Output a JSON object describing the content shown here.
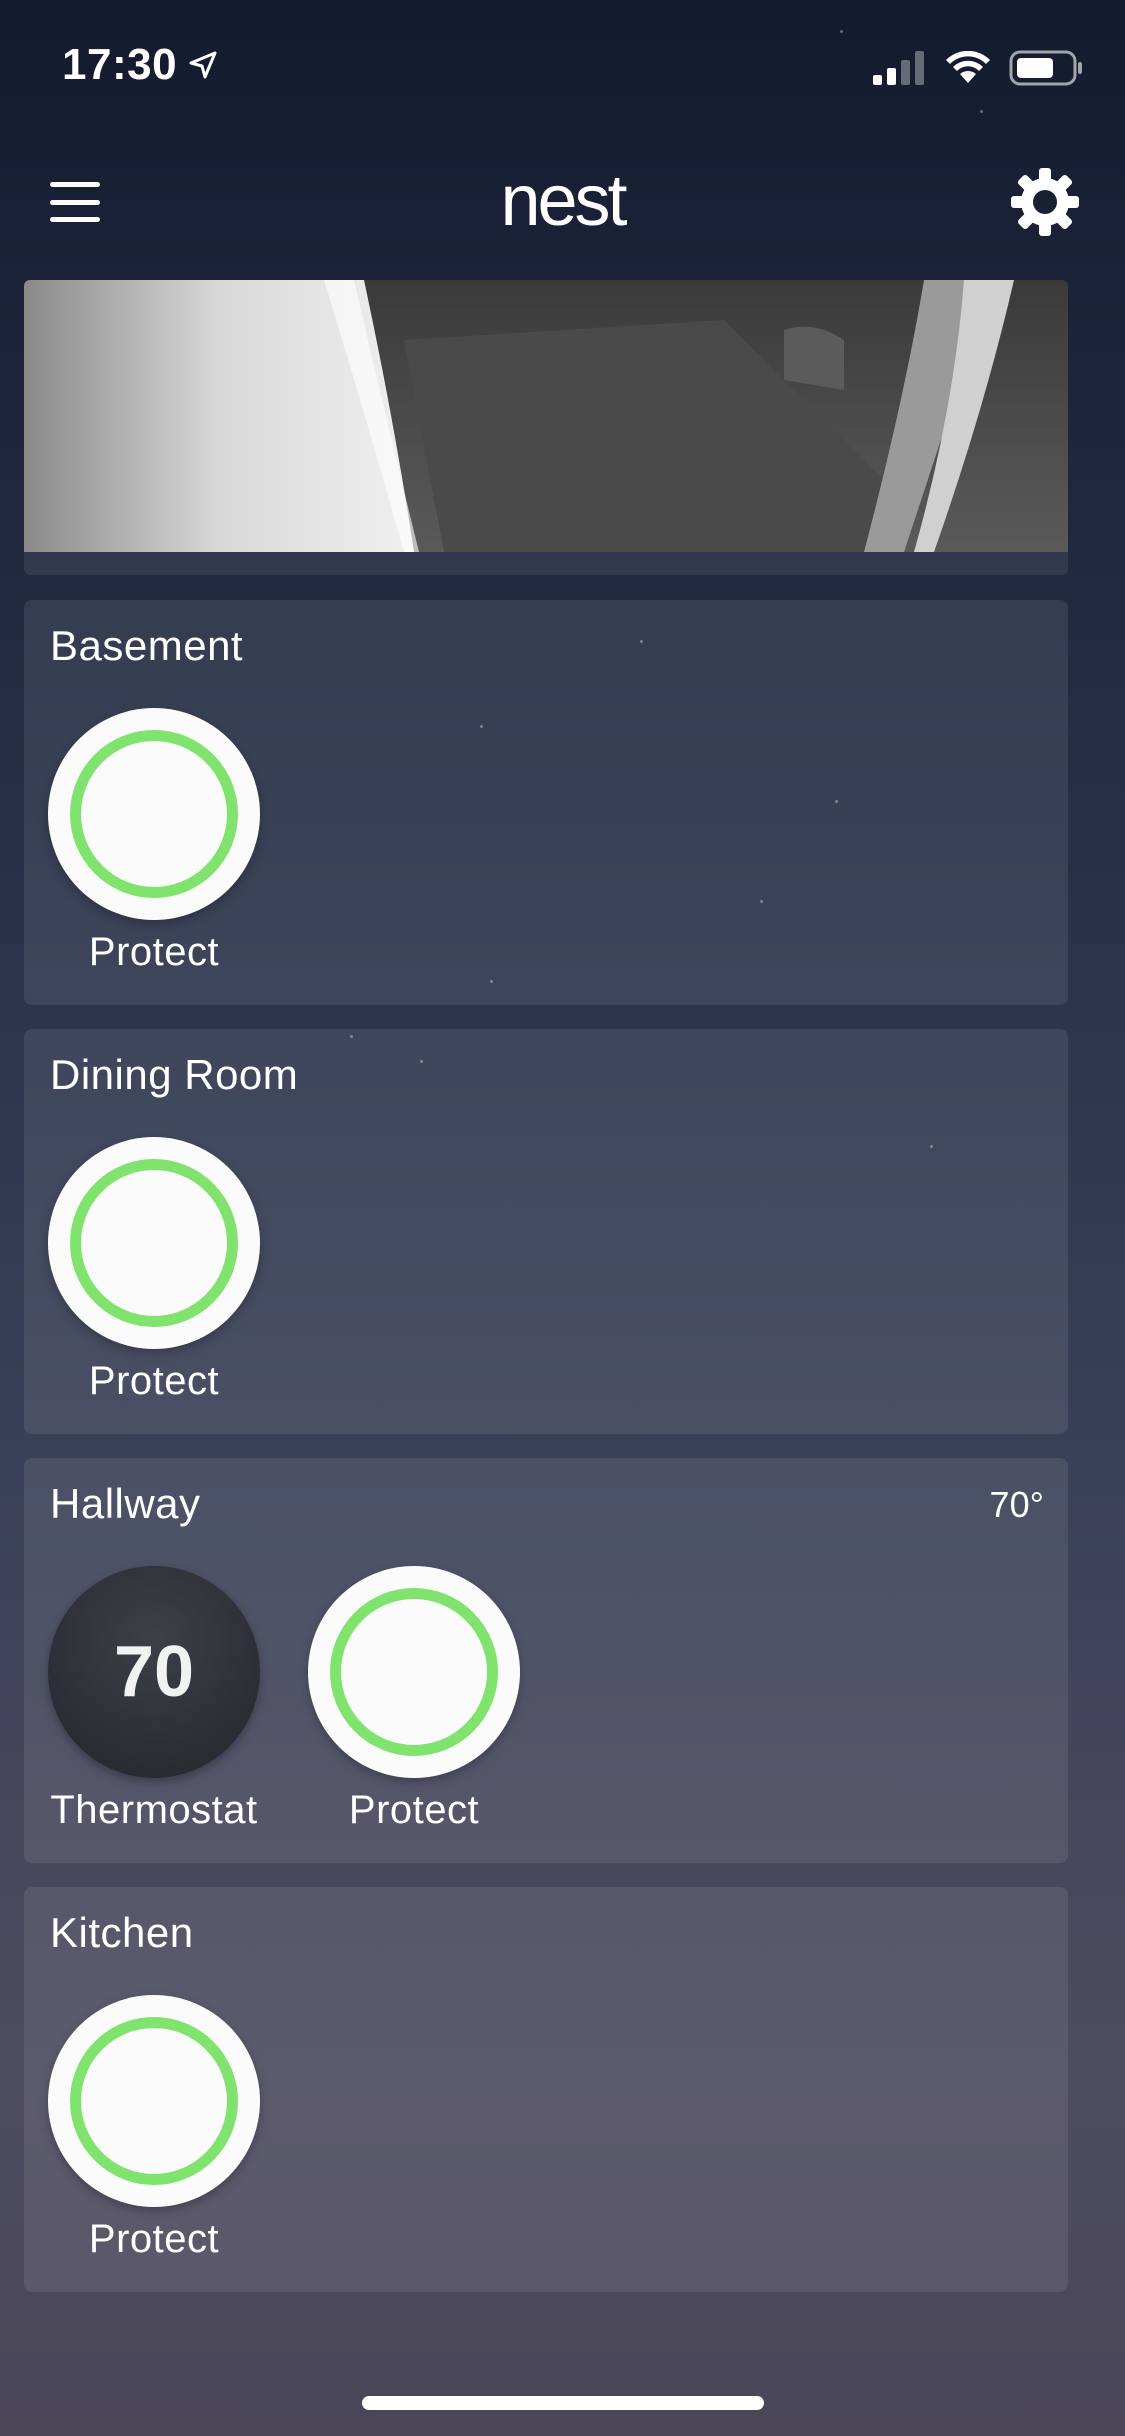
{
  "status_bar": {
    "time": "17:30"
  },
  "nav": {
    "logo": "nest"
  },
  "rooms": [
    {
      "name": "Basement",
      "temperature": "",
      "devices": [
        {
          "type": "protect",
          "label": "Protect"
        }
      ]
    },
    {
      "name": "Dining Room",
      "temperature": "",
      "devices": [
        {
          "type": "protect",
          "label": "Protect"
        }
      ]
    },
    {
      "name": "Hallway",
      "temperature": "70°",
      "devices": [
        {
          "type": "thermostat",
          "label": "Thermostat",
          "value": "70"
        },
        {
          "type": "protect",
          "label": "Protect"
        }
      ]
    },
    {
      "name": "Kitchen",
      "temperature": "",
      "devices": [
        {
          "type": "protect",
          "label": "Protect"
        }
      ]
    }
  ],
  "colors": {
    "protect_ring": "#7fe36e",
    "thermostat_face": "#2a2d33"
  },
  "icons": {
    "menu": "hamburger-icon",
    "settings": "gear-icon",
    "location": "location-arrow-icon",
    "signal": "cellular-signal-icon",
    "wifi": "wifi-icon",
    "battery": "battery-icon"
  }
}
